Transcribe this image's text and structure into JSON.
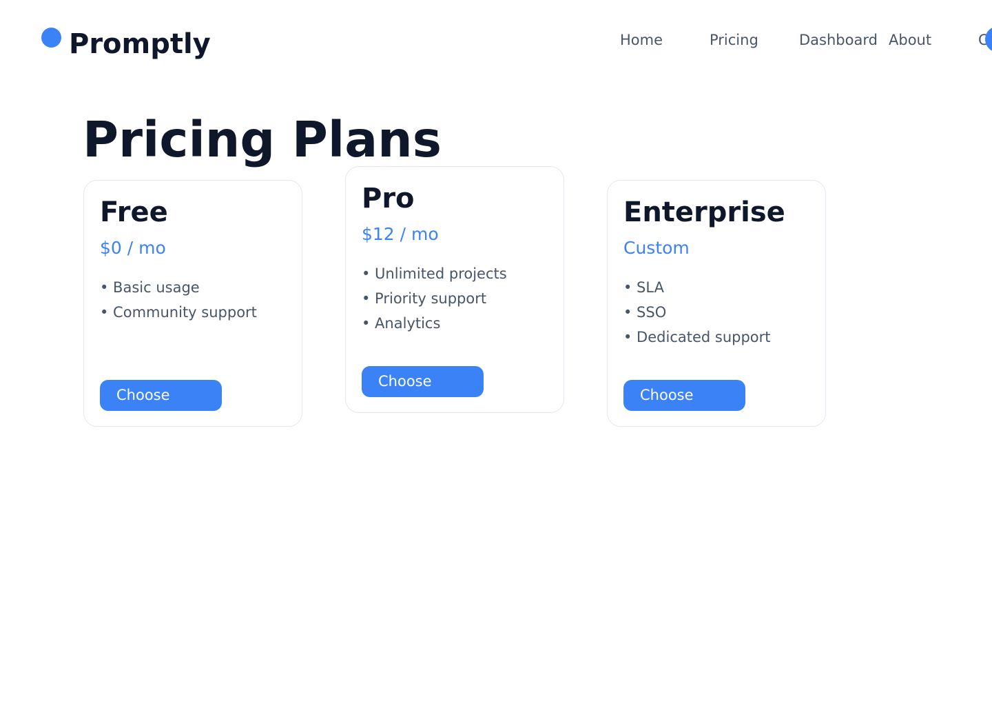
{
  "header": {
    "brand": "Promptly",
    "logo_icon": "circle-logo-icon",
    "nav": [
      "Home",
      "Pricing",
      "Dashboard",
      "About",
      "C"
    ],
    "avatar_icon": "circle-avatar-icon"
  },
  "main": {
    "title": "Pricing Plans",
    "plans": [
      {
        "name": "Free",
        "price": "$0 / mo",
        "features": [
          "• Basic usage",
          "• Community support"
        ],
        "button": "Choose"
      },
      {
        "name": "Pro",
        "price": "$12 / mo",
        "features": [
          "• Unlimited projects",
          "• Priority support",
          "• Analytics"
        ],
        "button": "Choose"
      },
      {
        "name": "Enterprise",
        "price": "Custom",
        "features": [
          "• SLA",
          "• SSO",
          "• Dedicated support"
        ],
        "button": "Choose"
      }
    ]
  },
  "colors": {
    "accent": "#3b82f6",
    "heading": "#0f172a",
    "body_text": "#475569",
    "card_border": "#e2e8f0",
    "background": "#ffffff"
  }
}
